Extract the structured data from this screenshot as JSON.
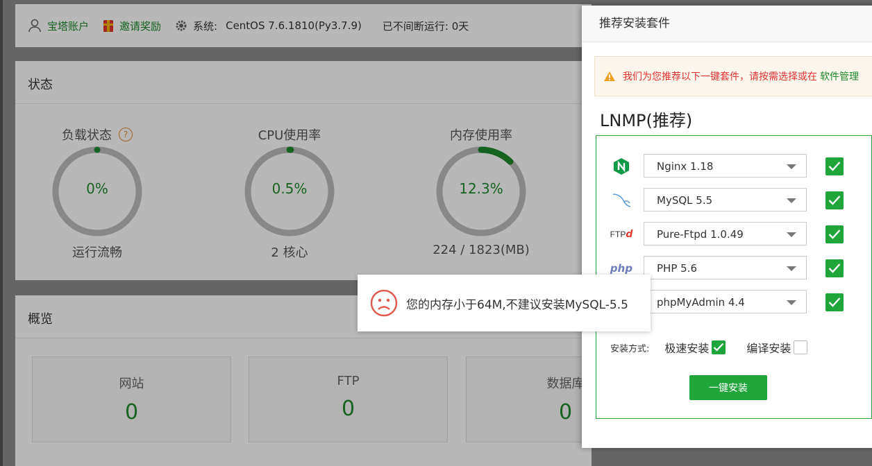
{
  "header": {
    "account_label": "宝塔账户",
    "invite_label": "邀请奖励",
    "system_label": "系统:",
    "system_value": "CentOS 7.6.1810(Py3.7.9)",
    "uptime_label": "已不间断运行: 0天"
  },
  "status": {
    "title": "状态",
    "gauges": [
      {
        "label": "负载状态",
        "value": "0%",
        "percent": 0,
        "sub": "运行流畅"
      },
      {
        "label": "CPU使用率",
        "value": "0.5%",
        "percent": 0.5,
        "sub": "2 核心"
      },
      {
        "label": "内存使用率",
        "value": "12.3%",
        "percent": 12.3,
        "sub": "224 / 1823(MB)"
      }
    ]
  },
  "overview": {
    "title": "概览",
    "cards": [
      {
        "label": "网站",
        "value": "0"
      },
      {
        "label": "FTP",
        "value": "0"
      },
      {
        "label": "数据库",
        "value": "0"
      }
    ]
  },
  "modal": {
    "title": "推荐安装套件",
    "warning_text": "我们为您推荐以下一键套件，请按需选择或在",
    "warning_link": "软件管理",
    "stack_title": "LNMP(推荐)",
    "packages": [
      {
        "icon": "nginx-icon",
        "selected": "Nginx 1.18",
        "checked": true
      },
      {
        "icon": "mysql-icon",
        "selected": "MySQL 5.5",
        "checked": true
      },
      {
        "icon": "ftp-icon",
        "selected": "Pure-Ftpd 1.0.49",
        "checked": true
      },
      {
        "icon": "php-icon",
        "selected": "PHP 5.6",
        "checked": true
      },
      {
        "icon": "phpmyadmin-icon",
        "selected": "phpMyAdmin 4.4",
        "checked": true
      }
    ],
    "install_mode_label": "安装方式:",
    "fast_install_label": "极速安装",
    "compile_install_label": "编译安装",
    "install_button": "一键安装",
    "ftp_icon_text": "FTP",
    "php_icon_text": "php"
  },
  "toast": {
    "message": "您的内存小于64M,不建议安装MySQL-5.5"
  },
  "colors": {
    "accent": "#20a53a",
    "warning": "#e0312f"
  }
}
